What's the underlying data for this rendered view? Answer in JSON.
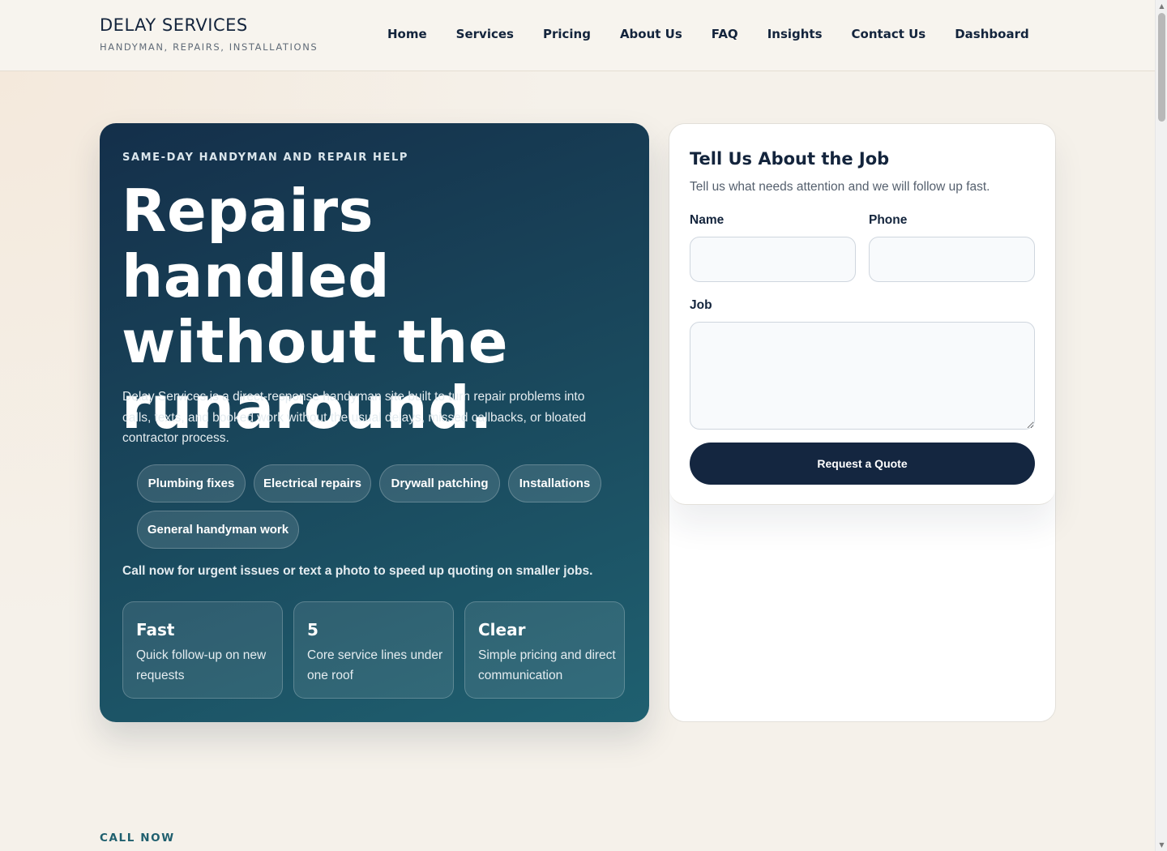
{
  "header": {
    "brand_name": "DELAY SERVICES",
    "brand_tagline": "HANDYMAN, REPAIRS, INSTALLATIONS",
    "nav": [
      "Home",
      "Services",
      "Pricing",
      "About Us",
      "FAQ",
      "Insights",
      "Contact Us",
      "Dashboard"
    ]
  },
  "hero": {
    "eyebrow": "SAME-DAY HANDYMAN AND REPAIR HELP",
    "title_lines": [
      "Repairs handled",
      "without the",
      "runaround."
    ],
    "description": "Delay Services is a direct-response handyman site built to turn repair problems into calls, texts, and booked work without the usual delays, missed callbacks, or bloated contractor process.",
    "chips": [
      "Plumbing fixes",
      "Electrical repairs",
      "Drywall patching",
      "Installations",
      "General handyman work"
    ],
    "call_line": "Call now for urgent issues or text a photo to speed up quoting on smaller jobs.",
    "stats": [
      {
        "title": "Fast",
        "text": "Quick follow-up on new requests"
      },
      {
        "title": "5",
        "text": "Core service lines under one roof"
      },
      {
        "title": "Clear",
        "text": "Simple pricing and direct communication"
      }
    ]
  },
  "form": {
    "title": "Tell Us About the Job",
    "subtitle": "Tell us what needs attention and we will follow up fast.",
    "name_label": "Name",
    "name_value": "",
    "phone_label": "Phone",
    "phone_value": "",
    "job_label": "Job",
    "job_value": "",
    "submit_label": "Request a Quote"
  },
  "next_section": {
    "kicker": "CALL NOW"
  },
  "colors": {
    "hero_gradient_start": "#142f4a",
    "hero_gradient_end": "#1f6070",
    "button": "#142640",
    "page_background": "#f5f1ea",
    "accent": "#1f5f6e"
  }
}
